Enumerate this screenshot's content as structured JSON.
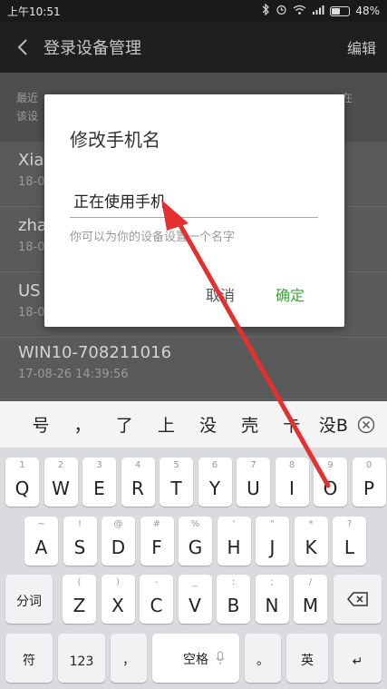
{
  "status": {
    "time": "上午10:51",
    "battery": "48%",
    "battery_level": 0.48
  },
  "header": {
    "title": "登录设备管理",
    "edit": "编辑"
  },
  "list": {
    "tip_left": "最近\n该设",
    "tip_right": "在",
    "items": [
      {
        "name": "Xia",
        "time": "18-0"
      },
      {
        "name": "zha",
        "time": "18-0"
      },
      {
        "name": "US",
        "time": "18-0"
      },
      {
        "name": "WIN10-708211016",
        "time": "17-08-26 14:39:56"
      }
    ]
  },
  "dialog": {
    "title": "修改手机名",
    "input_value": "正在使用手机",
    "hint": "你可以为你的设备设置一个名字",
    "cancel": "取消",
    "ok": "确定"
  },
  "candidates": [
    "号",
    "，",
    "了",
    "上",
    "没",
    "壳",
    "卡",
    "没B"
  ],
  "keyboard": {
    "row1": [
      {
        "k": "Q",
        "s": "1"
      },
      {
        "k": "W",
        "s": "2"
      },
      {
        "k": "E",
        "s": "3"
      },
      {
        "k": "R",
        "s": "4"
      },
      {
        "k": "T",
        "s": "5"
      },
      {
        "k": "Y",
        "s": "6"
      },
      {
        "k": "U",
        "s": "7"
      },
      {
        "k": "I",
        "s": "8"
      },
      {
        "k": "O",
        "s": "9"
      },
      {
        "k": "P",
        "s": "0"
      }
    ],
    "row2": [
      {
        "k": "A",
        "s": "~"
      },
      {
        "k": "S",
        "s": "!"
      },
      {
        "k": "D",
        "s": "@"
      },
      {
        "k": "F",
        "s": "#"
      },
      {
        "k": "G",
        "s": "%"
      },
      {
        "k": "H",
        "s": "'"
      },
      {
        "k": "J",
        "s": "\""
      },
      {
        "k": "K",
        "s": "*"
      },
      {
        "k": "L",
        "s": "?"
      }
    ],
    "row3": [
      {
        "k": "Z",
        "s": "("
      },
      {
        "k": "X",
        "s": ")"
      },
      {
        "k": "C",
        "s": "-"
      },
      {
        "k": "V",
        "s": "_"
      },
      {
        "k": "B",
        "s": ":"
      },
      {
        "k": "N",
        "s": ";"
      },
      {
        "k": "M",
        "s": "/"
      }
    ],
    "fenci": "分词",
    "fu": "符",
    "num": "123",
    "comma": "，",
    "space": "空格",
    "period": "。",
    "lang": "英",
    "enter": "↵"
  }
}
